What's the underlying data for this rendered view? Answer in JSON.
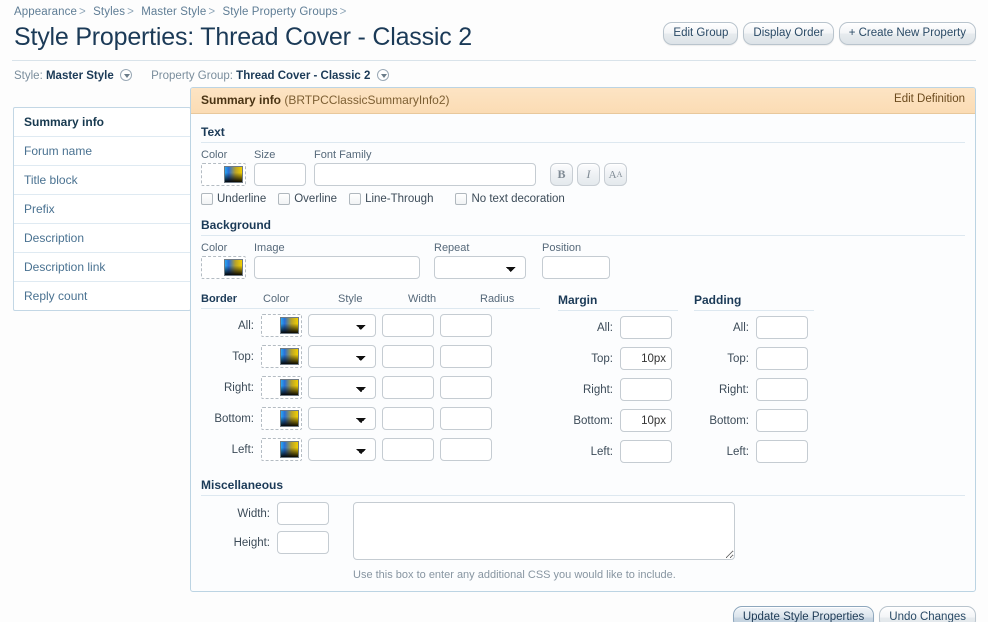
{
  "breadcrumb": [
    {
      "label": "Appearance"
    },
    {
      "label": "Styles"
    },
    {
      "label": "Master Style"
    },
    {
      "label": "Style Property Groups"
    }
  ],
  "header": {
    "title": "Style Properties: Thread Cover - Classic 2",
    "actions": [
      {
        "label": "Edit Group",
        "name": "edit-group-button"
      },
      {
        "label": "Display Order",
        "name": "display-order-button"
      },
      {
        "label": "+ Create New Property",
        "name": "create-new-property-button"
      }
    ]
  },
  "selectors": {
    "style_label": "Style:",
    "style_value": "Master Style",
    "group_label": "Property Group:",
    "group_value": "Thread Cover - Classic 2"
  },
  "sidebar": {
    "items": [
      {
        "label": "Summary info",
        "active": true
      },
      {
        "label": "Forum name",
        "active": false
      },
      {
        "label": "Title block",
        "active": false
      },
      {
        "label": "Prefix",
        "active": false
      },
      {
        "label": "Description",
        "active": false
      },
      {
        "label": "Description link",
        "active": false
      },
      {
        "label": "Reply count",
        "active": false
      }
    ]
  },
  "panel": {
    "head_name": "Summary info",
    "head_id": "(BRTPCClassicSummaryInfo2)",
    "edit_definition": "Edit Definition"
  },
  "text_section": {
    "title": "Text",
    "color_label": "Color",
    "color_value": "",
    "size_label": "Size",
    "size_value": "",
    "font_family_label": "Font Family",
    "font_family_value": "",
    "bold_label": "B",
    "italic_label": "I",
    "caps_label": "A",
    "caps_sub": "A",
    "decorations": [
      {
        "label": "Underline",
        "checked": false
      },
      {
        "label": "Overline",
        "checked": false
      },
      {
        "label": "Line-Through",
        "checked": false
      },
      {
        "label": "No text decoration",
        "checked": false
      }
    ]
  },
  "background_section": {
    "title": "Background",
    "color_label": "Color",
    "color_value": "",
    "image_label": "Image",
    "image_value": "",
    "repeat_label": "Repeat",
    "repeat_value": "",
    "position_label": "Position",
    "position_value": ""
  },
  "border_section": {
    "title": "Border",
    "columns": {
      "color": "Color",
      "style": "Style",
      "width": "Width",
      "radius": "Radius"
    },
    "rows": [
      {
        "label": "All:",
        "style": "",
        "width": "",
        "radius": ""
      },
      {
        "label": "Top:",
        "style": "",
        "width": "",
        "radius": ""
      },
      {
        "label": "Right:",
        "style": "",
        "width": "",
        "radius": ""
      },
      {
        "label": "Bottom:",
        "style": "",
        "width": "",
        "radius": ""
      },
      {
        "label": "Left:",
        "style": "",
        "width": "",
        "radius": ""
      }
    ]
  },
  "margin_section": {
    "title": "Margin",
    "rows": [
      {
        "label": "All:",
        "value": ""
      },
      {
        "label": "Top:",
        "value": "10px"
      },
      {
        "label": "Right:",
        "value": ""
      },
      {
        "label": "Bottom:",
        "value": "10px"
      },
      {
        "label": "Left:",
        "value": ""
      }
    ]
  },
  "padding_section": {
    "title": "Padding",
    "rows": [
      {
        "label": "All:",
        "value": ""
      },
      {
        "label": "Top:",
        "value": ""
      },
      {
        "label": "Right:",
        "value": ""
      },
      {
        "label": "Bottom:",
        "value": ""
      },
      {
        "label": "Left:",
        "value": ""
      }
    ]
  },
  "misc_section": {
    "title": "Miscellaneous",
    "width_label": "Width:",
    "width_value": "",
    "height_label": "Height:",
    "height_value": "",
    "css_value": "",
    "help": "Use this box to enter any additional CSS you would like to include."
  },
  "footer": {
    "update_label": "Update Style Properties",
    "undo_label": "Undo Changes"
  },
  "colors": {
    "accent": "#1b3a57",
    "panel_header": "#fbdcb4",
    "link": "#5f7d95"
  }
}
